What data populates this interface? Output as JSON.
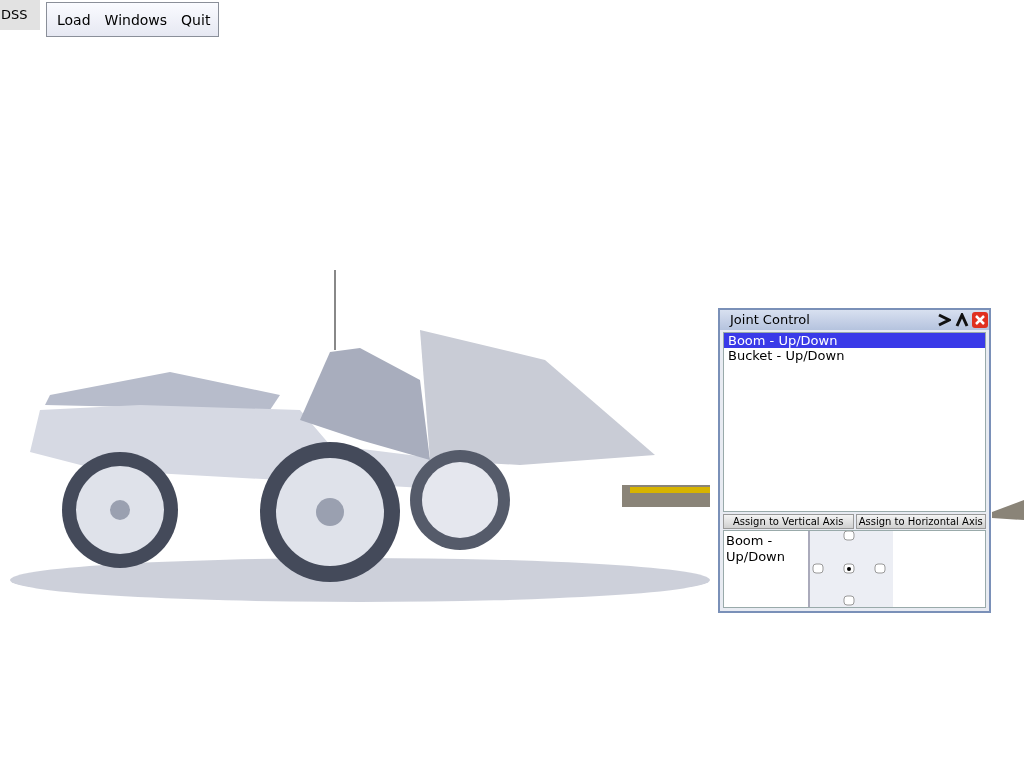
{
  "app_label": "DSS",
  "menu": [
    {
      "label": "Load"
    },
    {
      "label": "Windows"
    },
    {
      "label": "Quit"
    }
  ],
  "joint_window": {
    "title": "Joint Control",
    "joints": [
      {
        "label": "Boom - Up/Down",
        "selected": true
      },
      {
        "label": "Bucket - Up/Down",
        "selected": false
      }
    ],
    "buttons": [
      "Assign to Vertical Axis",
      "Assign to Horizontal Axis"
    ],
    "assigned": "Boom - Up/Down"
  }
}
